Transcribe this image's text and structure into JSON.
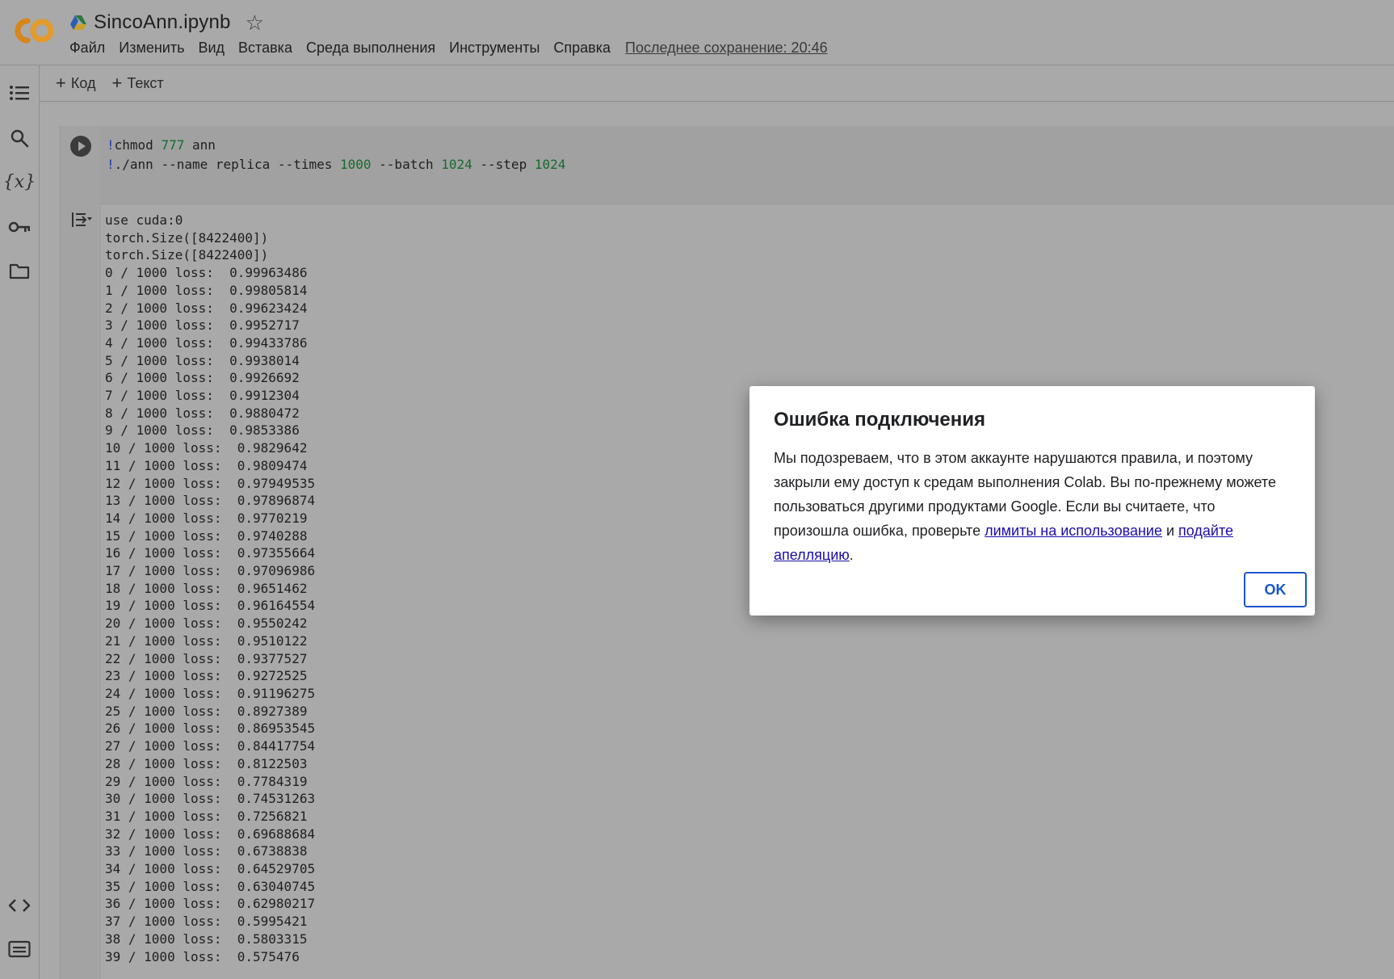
{
  "header": {
    "title": "SincoAnn.ipynb",
    "menu": [
      "Файл",
      "Изменить",
      "Вид",
      "Вставка",
      "Среда выполнения",
      "Инструменты",
      "Справка"
    ],
    "last_saved": "Последнее сохранение: 20:46"
  },
  "toolbar": {
    "add_code": "Код",
    "add_text": "Текст"
  },
  "sidebar": {
    "icons": [
      "table-of-contents-icon",
      "search-icon",
      "variables-icon",
      "secrets-key-icon",
      "files-folder-icon",
      "code-snippets-icon",
      "terminal-icon"
    ]
  },
  "cell": {
    "code_line1": {
      "bang": "!",
      "cmd": "chmod ",
      "num": "777",
      "rest": " ann"
    },
    "code_line2": {
      "bang": "!",
      "cmd": "./ann --name replica --times ",
      "n1": "1000",
      "mid1": " --batch ",
      "n2": "1024",
      "mid2": " --step ",
      "n3": "1024"
    },
    "output_lines": [
      "use cuda:0",
      "torch.Size([8422400])",
      "torch.Size([8422400])",
      "0 / 1000 loss:  0.99963486",
      "1 / 1000 loss:  0.99805814",
      "2 / 1000 loss:  0.99623424",
      "3 / 1000 loss:  0.9952717",
      "4 / 1000 loss:  0.99433786",
      "5 / 1000 loss:  0.9938014",
      "6 / 1000 loss:  0.9926692",
      "7 / 1000 loss:  0.9912304",
      "8 / 1000 loss:  0.9880472",
      "9 / 1000 loss:  0.9853386",
      "10 / 1000 loss:  0.9829642",
      "11 / 1000 loss:  0.9809474",
      "12 / 1000 loss:  0.97949535",
      "13 / 1000 loss:  0.97896874",
      "14 / 1000 loss:  0.9770219",
      "15 / 1000 loss:  0.9740288",
      "16 / 1000 loss:  0.97355664",
      "17 / 1000 loss:  0.97096986",
      "18 / 1000 loss:  0.9651462",
      "19 / 1000 loss:  0.96164554",
      "20 / 1000 loss:  0.9550242",
      "21 / 1000 loss:  0.9510122",
      "22 / 1000 loss:  0.9377527",
      "23 / 1000 loss:  0.9272525",
      "24 / 1000 loss:  0.91196275",
      "25 / 1000 loss:  0.8927389",
      "26 / 1000 loss:  0.86953545",
      "27 / 1000 loss:  0.84417754",
      "28 / 1000 loss:  0.8122503",
      "29 / 1000 loss:  0.7784319",
      "30 / 1000 loss:  0.74531263",
      "31 / 1000 loss:  0.7256821",
      "32 / 1000 loss:  0.69688684",
      "33 / 1000 loss:  0.6738838",
      "34 / 1000 loss:  0.64529705",
      "35 / 1000 loss:  0.63040745",
      "36 / 1000 loss:  0.62980217",
      "37 / 1000 loss:  0.5995421",
      "38 / 1000 loss:  0.5803315",
      "39 / 1000 loss:  0.575476"
    ]
  },
  "dialog": {
    "title": "Ошибка подключения",
    "body_text": "Мы подозреваем, что в этом аккаунте нарушаются правила, и поэтому закрыли ему доступ к средам выполнения Colab. Вы по-прежнему можете пользоваться другими продуктами Google. Если вы считаете, что произошла ошибка, проверьте ",
    "link_limits": "лимиты на использование",
    "and_word": " и ",
    "link_appeal": "подайте апелляцию",
    "period": ".",
    "ok_label": "OK"
  },
  "colors": {
    "overlay_gray": "#a9a9a9",
    "link_blue": "#1a0dab",
    "ok_blue": "#1a56c9",
    "code_number_green": "#166a30"
  }
}
